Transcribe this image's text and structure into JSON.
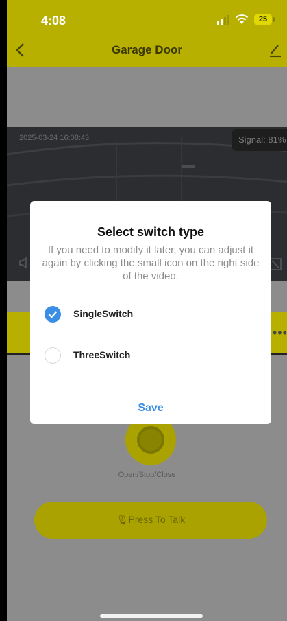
{
  "status_bar": {
    "time": "4:08",
    "battery": "25"
  },
  "nav": {
    "title": "Garage Door"
  },
  "video": {
    "timestamp": "2025-03-24 16:08:43",
    "signal": "Signal: 81%"
  },
  "controls": {
    "door_button_label": "Open/Stop/Close",
    "talk_label": "🎙Press To Talk"
  },
  "modal": {
    "title": "Select switch type",
    "description": "If you need to modify it later, you can adjust it again by clicking the small icon on the right side of the video.",
    "options": [
      {
        "label": "SingleSwitch",
        "selected": true
      },
      {
        "label": "ThreeSwitch",
        "selected": false
      }
    ],
    "save_label": "Save"
  },
  "colors": {
    "accent": "#3a8ee6",
    "brand_yellow_dimmed": "#b8b000"
  }
}
